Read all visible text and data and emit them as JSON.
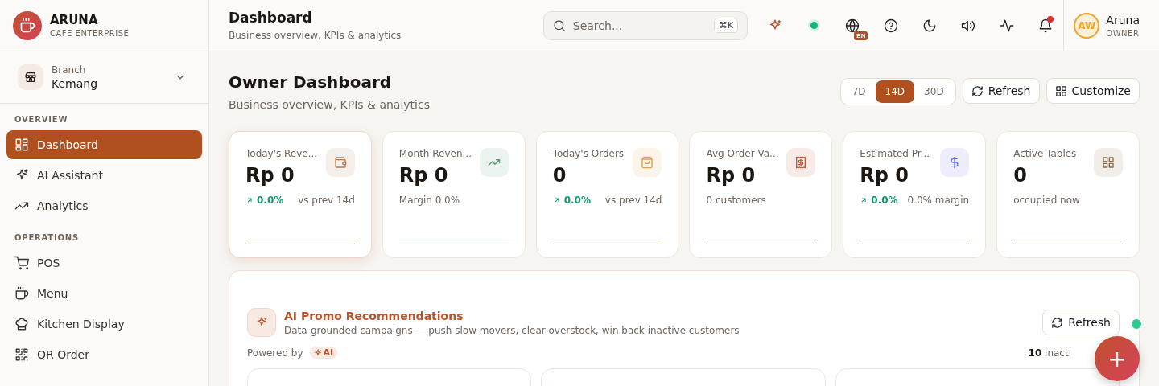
{
  "brand": {
    "name": "ARUNA",
    "subtitle": "CAFE ENTERPRISE"
  },
  "header": {
    "title": "Dashboard",
    "subtitle": "Business overview, KPIs & analytics",
    "search": {
      "placeholder": "Search...",
      "shortcut": "⌘K"
    },
    "status_online": true,
    "language": "EN",
    "notification": true
  },
  "user": {
    "initials": "AW",
    "name": "Aruna",
    "role": "OWNER"
  },
  "branch": {
    "label": "Branch",
    "value": "Kemang"
  },
  "sidebar": {
    "sections": [
      {
        "title": "OVERVIEW",
        "items": [
          {
            "label": "Dashboard",
            "selected": true
          },
          {
            "label": "AI Assistant",
            "selected": false
          },
          {
            "label": "Analytics",
            "selected": false
          }
        ]
      },
      {
        "title": "OPERATIONS",
        "items": [
          {
            "label": "POS",
            "selected": false
          },
          {
            "label": "Menu",
            "selected": false
          },
          {
            "label": "Kitchen Display",
            "selected": false
          },
          {
            "label": "QR Order",
            "selected": false
          }
        ]
      }
    ]
  },
  "page": {
    "title": "Owner Dashboard",
    "subtitle": "Business overview, KPIs & analytics"
  },
  "ranges": [
    {
      "label": "7D",
      "selected": false
    },
    {
      "label": "14D",
      "selected": true
    },
    {
      "label": "30D",
      "selected": false
    }
  ],
  "actions": [
    "Refresh",
    "Customize"
  ],
  "kpis": [
    {
      "label": "Today's Reve...",
      "value": "Rp 0",
      "delta": "0.0%",
      "note": "vs prev 14d",
      "color": "#b07a4f",
      "selected": true
    },
    {
      "label": "Month Reven...",
      "value": "Rp 0",
      "note": "Margin 0.0%",
      "color": "#5a9a72",
      "selected": false
    },
    {
      "label": "Today's Orders",
      "value": "0",
      "delta": "0.0%",
      "note": "vs prev 14d",
      "color": "#d9a24a",
      "selected": false
    },
    {
      "label": "Avg Order Va...",
      "value": "Rp 0",
      "note": "0 customers",
      "color": "#c8573a",
      "selected": false
    },
    {
      "label": "Estimated Pr...",
      "value": "Rp 0",
      "delta": "0.0%",
      "note": "0.0% margin",
      "color": "#6b6ef0",
      "selected": false
    },
    {
      "label": "Active Tables",
      "value": "0",
      "note": "occupied now",
      "color": "#8a6a48",
      "selected": false
    }
  ],
  "promo": {
    "title": "AI Promo Recommendations",
    "description": "Data-grounded campaigns — push slow movers, clear overstock, win back inactive customers",
    "refresh": "Refresh",
    "powered_by": "Powered by",
    "badge": "AI",
    "count": "10",
    "count_label": "inacti"
  },
  "fab": {
    "label": "+",
    "online": true
  }
}
